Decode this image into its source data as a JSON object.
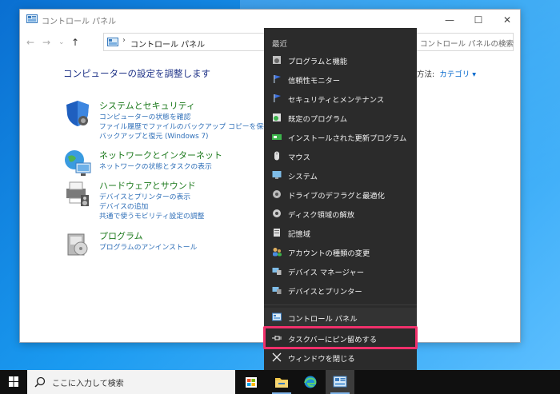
{
  "window": {
    "title": "コントロール パネル",
    "controls": {
      "minimize": "—",
      "maximize": "☐",
      "close": "✕"
    },
    "nav": {
      "back": "←",
      "forward": "→",
      "dropdown": "⌄",
      "up": "↑"
    },
    "address": {
      "separator": "›",
      "crumb": "コントロール パネル"
    },
    "search_placeholder": "コントロール パネルの検索"
  },
  "main": {
    "heading": "コンピューターの設定を調整します",
    "view_by_label": "方法:",
    "view_by_value": "カテゴリ ▾",
    "categories": [
      {
        "title": "システムとセキュリティ",
        "links": [
          "コンピューターの状態を確認",
          "ファイル履歴でファイルのバックアップ コピーを保存",
          "バックアップと復元 (Windows 7)"
        ]
      },
      {
        "title": "ネットワークとインターネット",
        "links": [
          "ネットワークの状態とタスクの表示"
        ]
      },
      {
        "title": "ハードウェアとサウンド",
        "links": [
          "デバイスとプリンターの表示",
          "デバイスの追加",
          "共通で使うモビリティ設定の調整"
        ]
      },
      {
        "title": "プログラム",
        "links": [
          "プログラムのアンインストール"
        ]
      }
    ]
  },
  "jumplist": {
    "recent_header": "最近",
    "items": [
      {
        "label": "プログラムと機能",
        "icon": "programs-features-icon"
      },
      {
        "label": "信頼性モニター",
        "icon": "flag-icon"
      },
      {
        "label": "セキュリティとメンテナンス",
        "icon": "flag-icon"
      },
      {
        "label": "既定のプログラム",
        "icon": "default-programs-icon"
      },
      {
        "label": "インストールされた更新プログラム",
        "icon": "updates-icon"
      },
      {
        "label": "マウス",
        "icon": "mouse-icon"
      },
      {
        "label": "システム",
        "icon": "system-icon"
      },
      {
        "label": "ドライブのデフラグと最適化",
        "icon": "defrag-icon"
      },
      {
        "label": "ディスク領域の解放",
        "icon": "disk-cleanup-icon"
      },
      {
        "label": "記憶域",
        "icon": "storage-icon"
      },
      {
        "label": "アカウントの種類の変更",
        "icon": "users-icon"
      },
      {
        "label": "デバイス マネージャー",
        "icon": "device-manager-icon"
      },
      {
        "label": "デバイスとプリンター",
        "icon": "devices-printers-icon"
      }
    ],
    "app_item": "コントロール パネル",
    "pin_item": "タスクバーにピン留めする",
    "close_item": "ウィンドウを閉じる"
  },
  "taskbar": {
    "search_placeholder": "ここに入力して検索",
    "apps": [
      "store-icon",
      "file-explorer-icon",
      "edge-icon",
      "control-panel-icon"
    ]
  },
  "colors": {
    "highlight": "#f0306b",
    "jumplist_bg": "#2b2b2b",
    "link_blue": "#2f6fb8",
    "category_green": "#1d7a1d",
    "heading_blue": "#1e3287"
  }
}
